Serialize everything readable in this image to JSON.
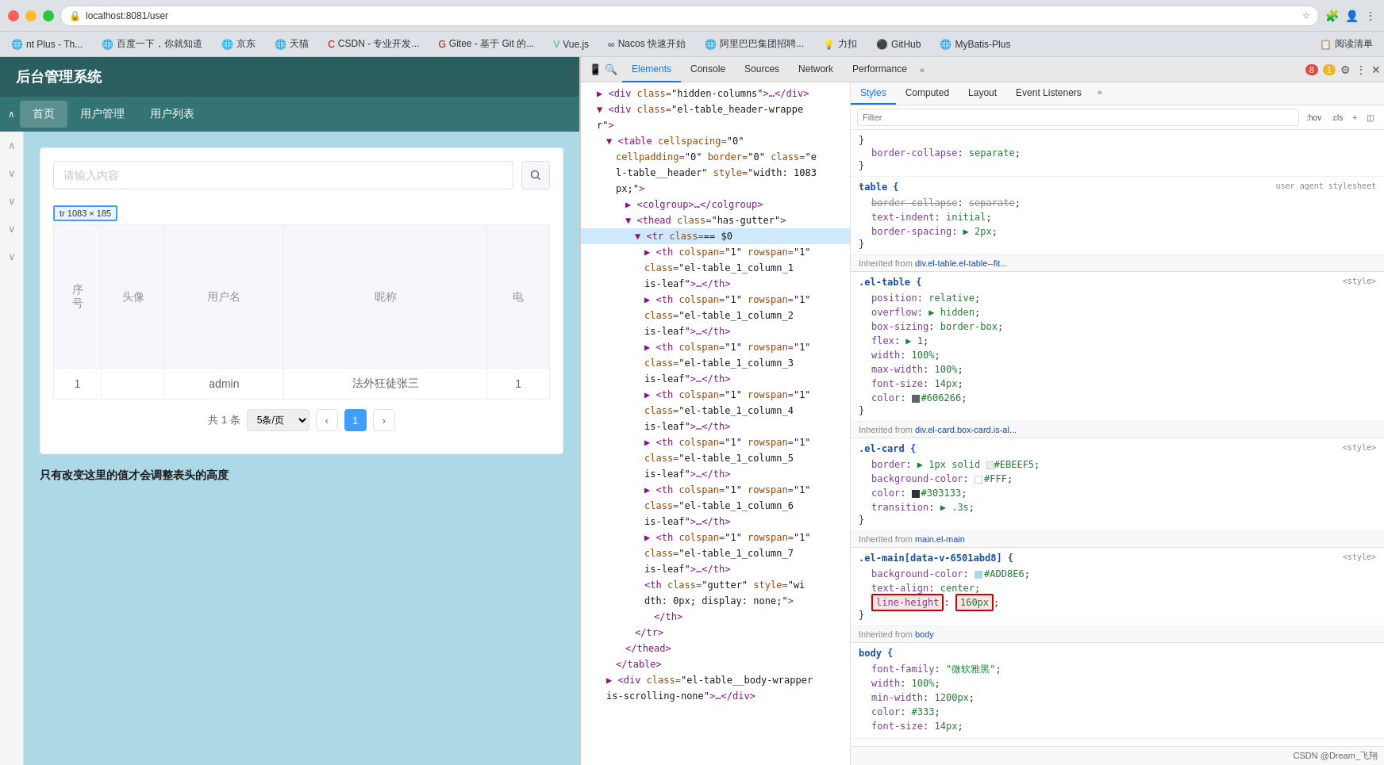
{
  "browser": {
    "url": "localhost:8081/user",
    "bookmarks": [
      {
        "label": "nt Plus - Th...",
        "icon": "🌐"
      },
      {
        "label": "百度一下，你就知道",
        "icon": "🌐"
      },
      {
        "label": "京东",
        "icon": "🌐"
      },
      {
        "label": "天猫",
        "icon": "🌐"
      },
      {
        "label": "CSDN - 专业开发...",
        "icon": "🌐"
      },
      {
        "label": "Gitee - 基于 Git 的...",
        "icon": "🌐"
      },
      {
        "label": "Vue.js",
        "icon": "🌐"
      },
      {
        "label": "Nacos 快速开始",
        "icon": "🌐"
      },
      {
        "label": "阿里巴巴集团招聘...",
        "icon": "🌐"
      },
      {
        "label": "力扣",
        "icon": "🌐"
      },
      {
        "label": "GitHub",
        "icon": "🌐"
      },
      {
        "label": "MyBatis-Plus",
        "icon": "🌐"
      },
      {
        "label": "阅读清单",
        "icon": "📋"
      }
    ],
    "devtools_error_count": "8",
    "devtools_warning_count": "1"
  },
  "app": {
    "title": "后台管理系统",
    "nav": [
      "首页",
      "用户管理",
      "用户列表"
    ],
    "nav_active": "首页",
    "search_placeholder": "请输入内容",
    "table": {
      "headers": [
        "序\n号",
        "头像",
        "用户名",
        "昵称",
        "电"
      ],
      "rows": [
        [
          "1",
          "",
          "admin",
          "法外狂徒张三",
          "1"
        ]
      ]
    },
    "pagination": {
      "total": "共 1 条",
      "per_page": "5条/页",
      "current_page": "1"
    },
    "tr_tooltip": "tr  1083 × 185",
    "annotation": "只有改变这里的值才会调整表头的高度"
  },
  "devtools": {
    "tabs": [
      "Elements",
      "Console",
      "Sources",
      "Network",
      "Performance"
    ],
    "tab_active": "Elements",
    "styles_tabs": [
      "Styles",
      "Computed",
      "Layout",
      "Event Listeners"
    ],
    "styles_tab_active": "Styles",
    "filter_placeholder": "Filter",
    "filter_hint": ":hov .cls",
    "dom_lines": [
      {
        "indent": 1,
        "html": "<span class='tag'>▶</span> <span class='tag'>&lt;div</span> <span class='attr-name'>class=</span><span class='attr-value'>\"hidden-columns\"</span><span class='tag'>&gt;…&lt;/div&gt;</span>"
      },
      {
        "indent": 1,
        "html": "<span class='tag'>▼</span> <span class='tag'>&lt;div</span> <span class='attr-name'>class=</span><span class='attr-value'>\"el-table_header-wrappe r\"</span><span class='tag'>&gt;</span>"
      },
      {
        "indent": 2,
        "html": "<span class='tag'>▼</span> <span class='tag'>&lt;table</span> <span class='attr-name'>cellspacing=</span><span class='attr-value'>\"0\"</span>"
      },
      {
        "indent": 3,
        "html": "<span class='attr-name'>cellpadding=</span><span class='attr-value'>\"0\"</span> <span class='attr-name'>border=</span><span class='attr-value'>\"0\"</span> <span class='attr-name'>class=</span><span class='attr-value'>\"e</span>"
      },
      {
        "indent": 3,
        "html": "<span class='attr-value'>l-table__header\"</span> <span class='attr-name'>style=</span><span class='attr-value'>\"width: 1083</span>"
      },
      {
        "indent": 3,
        "html": "<span class='attr-value'>px;\"</span><span class='tag'>&gt;</span>"
      },
      {
        "indent": 4,
        "html": "<span class='tag'>▶</span> <span class='tag'>&lt;colgroup&gt;</span>…<span class='tag'>&lt;/colgroup&gt;</span>"
      },
      {
        "indent": 4,
        "html": "<span class='tag'>▼</span> <span class='tag'>&lt;thead</span> <span class='attr-name'>class=</span><span class='attr-value'>\"has-gutter\"</span><span class='tag'>&gt;</span>"
      },
      {
        "indent": 5,
        "html": "<span class='tag'>▼</span> <span class='tag'>&lt;tr</span> <span class='attr-name'>class=</span><span class='attr-value'>\"== $0</span>"
      },
      {
        "indent": 6,
        "html": "<span class='tag'>▶</span> <span class='tag'>&lt;th</span> <span class='attr-name'>colspan=</span><span class='attr-value'>\"1\"</span> <span class='attr-name'>rowspan=</span><span class='attr-value'>\"1\"</span>"
      },
      {
        "indent": 6,
        "html": "<span class='attr-name'>class=</span><span class='attr-value'>\"el-table_1_column_1</span>"
      },
      {
        "indent": 6,
        "html": "<span class='attr-value'>is-leaf\"</span><span class='tag'>&gt;…&lt;/th&gt;</span>"
      },
      {
        "indent": 6,
        "html": "<span class='tag'>▶</span> <span class='tag'>&lt;th</span> <span class='attr-name'>colspan=</span><span class='attr-value'>\"1\"</span> <span class='attr-name'>rowspan=</span><span class='attr-value'>\"1\"</span>"
      },
      {
        "indent": 6,
        "html": "<span class='attr-name'>class=</span><span class='attr-value'>\"el-table_1_column_2</span>"
      },
      {
        "indent": 6,
        "html": "<span class='attr-value'>is-leaf\"</span><span class='tag'>&gt;…&lt;/th&gt;</span>"
      },
      {
        "indent": 6,
        "html": "<span class='tag'>▶</span> <span class='tag'>&lt;th</span> <span class='attr-name'>colspan=</span><span class='attr-value'>\"1\"</span> <span class='attr-name'>rowspan=</span><span class='attr-value'>\"1\"</span>"
      },
      {
        "indent": 6,
        "html": "<span class='attr-name'>class=</span><span class='attr-value'>\"el-table_1_column_3</span>"
      },
      {
        "indent": 6,
        "html": "<span class='attr-value'>is-leaf\"</span><span class='tag'>&gt;…&lt;/th&gt;</span>"
      },
      {
        "indent": 6,
        "html": "<span class='tag'>▶</span> <span class='tag'>&lt;th</span> <span class='attr-name'>colspan=</span><span class='attr-value'>\"1\"</span> <span class='attr-name'>rowspan=</span><span class='attr-value'>\"1\"</span>"
      },
      {
        "indent": 6,
        "html": "<span class='attr-name'>class=</span><span class='attr-value'>\"el-table_1_column_4</span>"
      },
      {
        "indent": 6,
        "html": "<span class='attr-value'>is-leaf\"</span><span class='tag'>&gt;…&lt;/th&gt;</span>"
      },
      {
        "indent": 6,
        "html": "<span class='tag'>▶</span> <span class='tag'>&lt;th</span> <span class='attr-name'>colspan=</span><span class='attr-value'>\"1\"</span> <span class='attr-name'>rowspan=</span><span class='attr-value'>\"1\"</span>"
      },
      {
        "indent": 6,
        "html": "<span class='attr-name'>class=</span><span class='attr-value'>\"el-table_1_column_5</span>"
      },
      {
        "indent": 6,
        "html": "<span class='attr-value'>is-leaf\"</span><span class='tag'>&gt;…&lt;/th&gt;</span>"
      },
      {
        "indent": 6,
        "html": "<span class='tag'>▶</span> <span class='tag'>&lt;th</span> <span class='attr-name'>colspan=</span><span class='attr-value'>\"1\"</span> <span class='attr-name'>rowspan=</span><span class='attr-value'>\"1\"</span>"
      },
      {
        "indent": 6,
        "html": "<span class='attr-name'>class=</span><span class='attr-value'>\"el-table_1_column_6</span>"
      },
      {
        "indent": 6,
        "html": "<span class='attr-value'>is-leaf\"</span><span class='tag'>&gt;…&lt;/th&gt;</span>"
      },
      {
        "indent": 6,
        "html": "<span class='tag'>▶</span> <span class='tag'>&lt;th</span> <span class='attr-name'>colspan=</span><span class='attr-value'>\"1\"</span> <span class='attr-name'>rowspan=</span><span class='attr-value'>\"1\"</span>"
      },
      {
        "indent": 6,
        "html": "<span class='attr-name'>class=</span><span class='attr-value'>\"el-table_1_column_7</span>"
      },
      {
        "indent": 6,
        "html": "<span class='attr-value'>is-leaf\"</span><span class='tag'>&gt;…&lt;/th&gt;</span>"
      },
      {
        "indent": 6,
        "html": "<span class='tag'>&lt;th</span> <span class='attr-name'>class=</span><span class='attr-value'>\"gutter\"</span> <span class='attr-name'>style=</span><span class='attr-value'>\"wi</span>"
      },
      {
        "indent": 6,
        "html": "<span class='attr-value'>dth: 0px; display: none;\"</span><span class='tag'>&gt;</span>"
      },
      {
        "indent": 7,
        "html": "</span><span class='tag'>&lt;/th&gt;</span>"
      },
      {
        "indent": 5,
        "html": "<span class='tag'>&lt;/tr&gt;</span>"
      },
      {
        "indent": 4,
        "html": "<span class='tag'>&lt;/thead&gt;</span>"
      },
      {
        "indent": 3,
        "html": "<span class='tag'>&lt;/table&gt;</span>"
      },
      {
        "indent": 2,
        "html": "<span class='tag'>▶</span> <span class='tag'>&lt;div</span> <span class='attr-name'>class=</span><span class='attr-value'>\"el-table__body-wrapper</span>"
      },
      {
        "indent": 2,
        "html": "<span class='attr-value'>is-scrolling-none\"</span><span class='tag'>&gt;…&lt;/div&gt;</span>"
      }
    ],
    "styles": {
      "rules": [
        {
          "selector": "",
          "source": "",
          "props": [
            {
              "name": "border-collapse",
              "value": "separate",
              "strikethrough": false
            }
          ]
        },
        {
          "selector": "table {",
          "source": "user agent stylesheet",
          "props": [
            {
              "name": "border-collapse",
              "value": "separate",
              "strikethrough": true
            },
            {
              "name": "text-indent",
              "value": "initial",
              "strikethrough": false
            },
            {
              "name": "border-spacing",
              "value": "▶ 2px",
              "strikethrough": false
            }
          ]
        },
        {
          "inherited_from": "div.el-table.el-table--fit...",
          "selector": ".el-table {",
          "source": "<style>",
          "props": [
            {
              "name": "position",
              "value": "relative",
              "strikethrough": false
            },
            {
              "name": "overflow",
              "value": "▶ hidden",
              "strikethrough": false
            },
            {
              "name": "box-sizing",
              "value": "border-box",
              "strikethrough": false
            },
            {
              "name": "flex",
              "value": "▶ 1",
              "strikethrough": false
            },
            {
              "name": "width",
              "value": "100%",
              "strikethrough": false
            },
            {
              "name": "max-width",
              "value": "100%",
              "strikethrough": false
            },
            {
              "name": "font-size",
              "value": "14px",
              "strikethrough": false
            },
            {
              "name": "color",
              "value": "■ #606266",
              "strikethrough": false
            }
          ]
        },
        {
          "inherited_from": "div.el-card.box-card.is-al...",
          "selector": ".el-card {",
          "source": "<style>",
          "props": [
            {
              "name": "border",
              "value": "▶ 1px solid □#EBEEF5",
              "strikethrough": false
            },
            {
              "name": "background-color",
              "value": "□ #FFF",
              "strikethrough": false
            },
            {
              "name": "color",
              "value": "■ #303133",
              "strikethrough": false
            },
            {
              "name": "transition",
              "value": "▶ .3s",
              "strikethrough": false
            }
          ]
        },
        {
          "inherited_from": "main.el-main",
          "selector": ".el-main[data-v-6501abd8] {",
          "source": "<style>",
          "props": [
            {
              "name": "background-color",
              "value": "■ #ADD8E6",
              "strikethrough": false
            },
            {
              "name": "text-align",
              "value": "center",
              "strikethrough": false
            },
            {
              "name": "line-height",
              "value": "160px",
              "strikethrough": false,
              "highlight": true
            }
          ]
        },
        {
          "inherited_from": "body",
          "selector": "body {",
          "source": "",
          "props": [
            {
              "name": "font-family",
              "value": "\"微软雅黑\"",
              "strikethrough": false
            },
            {
              "name": "width",
              "value": "100%",
              "strikethrough": false
            },
            {
              "name": "min-width",
              "value": "1200px",
              "strikethrough": false
            },
            {
              "name": "color",
              "value": "#333",
              "strikethrough": false
            },
            {
              "name": "font-size",
              "value": "14px",
              "strikethrough": false
            }
          ]
        }
      ]
    }
  },
  "watermark": "CSDN @Dream_飞翔"
}
